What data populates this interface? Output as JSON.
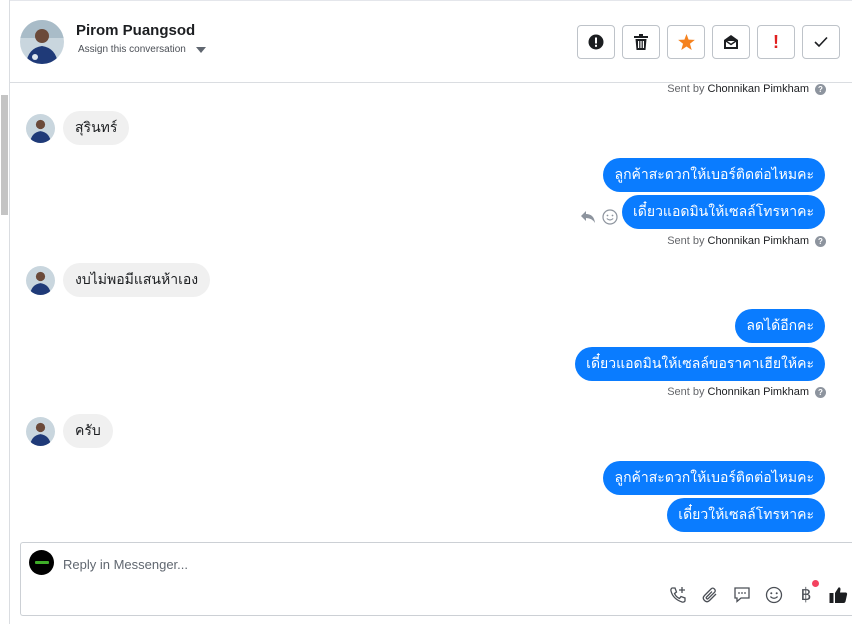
{
  "conversation": {
    "name": "Pirom Puangsod",
    "assign_label": "Assign this conversation"
  },
  "actions": [
    {
      "name": "spam",
      "icon": "exclamation-circle-icon"
    },
    {
      "name": "delete",
      "icon": "trash-icon"
    },
    {
      "name": "star",
      "icon": "star-icon",
      "color": "#f5821f"
    },
    {
      "name": "archive",
      "icon": "archive-icon"
    },
    {
      "name": "follow-up",
      "icon": "red-exclamation-icon",
      "label": "!",
      "color": "#e02020"
    },
    {
      "name": "done",
      "icon": "checkmark-icon"
    }
  ],
  "thread": {
    "sent_prefix": "Sent by",
    "sender": "Chonnikan Pimkham",
    "help_glyph": "?",
    "messages": [
      {
        "dir": "in",
        "text": "สุรินทร์"
      },
      {
        "dir": "out",
        "text": "ลูกค้าสะดวกให้เบอร์ติดต่อไหมคะ"
      },
      {
        "dir": "out",
        "text": "เดี๋ยวแอดมินให้เซลล์โทรหาคะ"
      },
      {
        "dir": "in",
        "text": "งบไม่พอมีแสนห้าเอง"
      },
      {
        "dir": "out",
        "text": "ลดได้อีกคะ"
      },
      {
        "dir": "out",
        "text": "เดี๋ยวแอดมินให้เซลล์ขอราคาเฮียให้คะ"
      },
      {
        "dir": "in",
        "text": "ครับ"
      },
      {
        "dir": "out",
        "text": "ลูกค้าสะดวกให้เบอร์ติดต่อไหมคะ"
      },
      {
        "dir": "out",
        "text": "เดี๋ยวให้เซลล์โทรหาคะ"
      }
    ]
  },
  "composer": {
    "placeholder": "Reply in Messenger...",
    "tools": [
      "call-add-icon",
      "attachment-icon",
      "saved-replies-icon",
      "emoji-icon",
      "baht-payment-icon",
      "like-icon"
    ],
    "baht_symbol": "฿"
  },
  "colors": {
    "outgoing_bubble": "#0a7cff",
    "incoming_bubble": "#f0f0f0",
    "notification_dot": "#f3425f"
  }
}
